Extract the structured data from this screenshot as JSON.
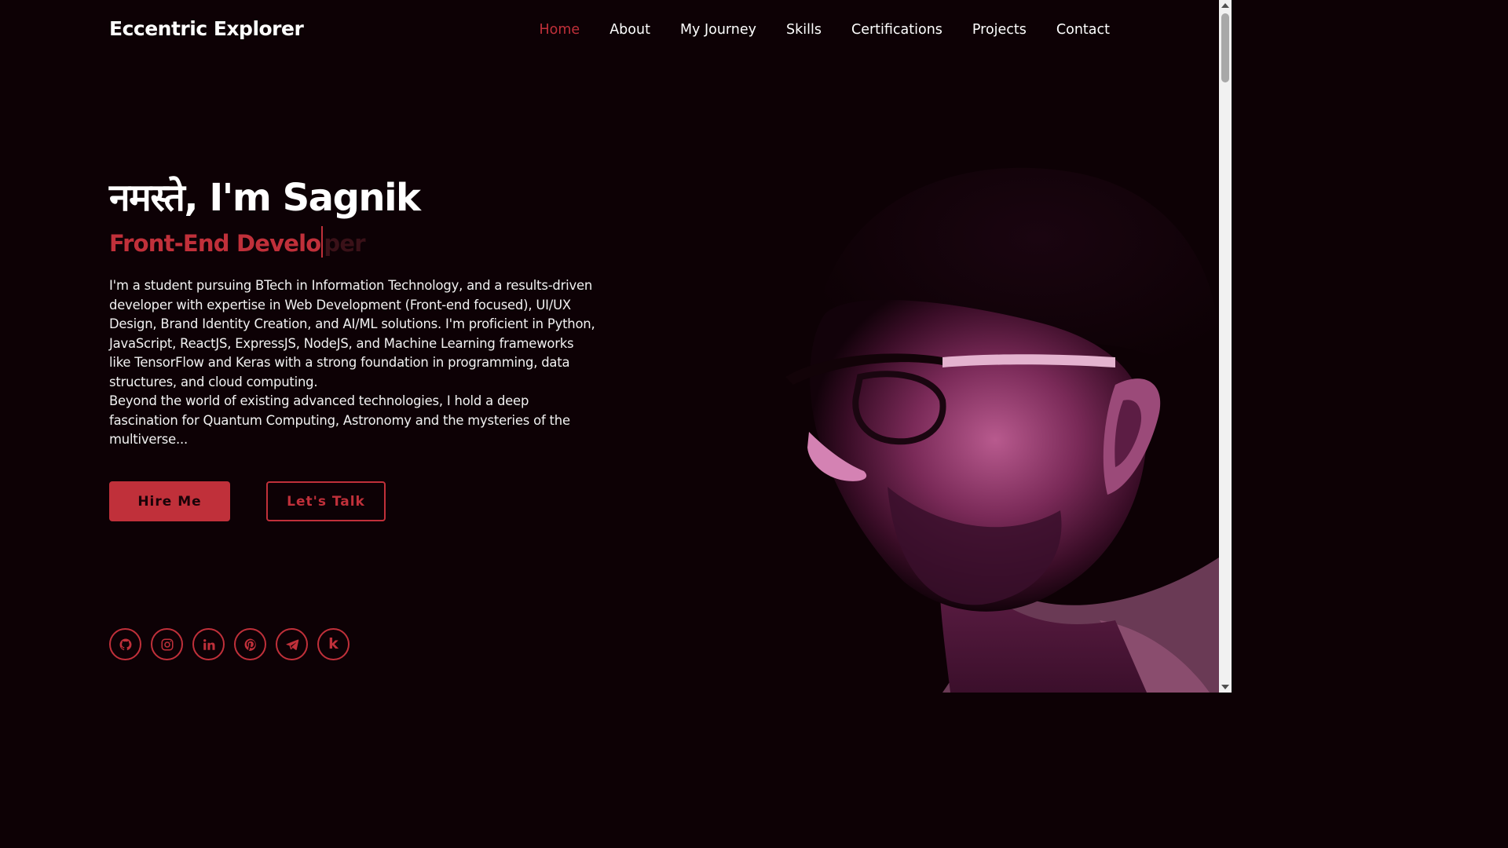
{
  "header": {
    "brand": "Eccentric Explorer",
    "nav": [
      {
        "label": "Home",
        "active": true
      },
      {
        "label": "About"
      },
      {
        "label": "My Journey"
      },
      {
        "label": "Skills"
      },
      {
        "label": "Certifications"
      },
      {
        "label": "Projects"
      },
      {
        "label": "Contact"
      }
    ]
  },
  "hero": {
    "greeting": "नमस्ते, I'm Sagnik",
    "role_typed": "Front-End Develo",
    "role_remaining": "per",
    "bio_paragraphs": [
      "I'm a student pursuing BTech in Information Technology, and a results-driven developer with expertise in Web Development (Front-end focused), UI/UX Design, Brand Identity Creation, and AI/ML solutions. I'm proficient in Python, JavaScript, ReactJS, ExpressJS, NodeJS, and Machine Learning frameworks like TensorFlow and Keras with a strong foundation in programming, data structures, and cloud computing.",
      "Beyond the world of existing advanced technologies, I hold a deep fascination for Quantum Computing, Astronomy and the mysteries of the multiverse..."
    ],
    "buttons": {
      "hire": "Hire Me",
      "talk": "Let's Talk"
    }
  },
  "socials": [
    {
      "icon": "github-icon"
    },
    {
      "icon": "instagram-icon"
    },
    {
      "icon": "linkedin-icon"
    },
    {
      "icon": "pinterest-icon"
    },
    {
      "icon": "telegram-icon"
    },
    {
      "icon": "kaggle-icon",
      "glyph": "k"
    }
  ],
  "colors": {
    "background": "#0d0105",
    "accent": "#c0303a",
    "text": "#ffffff"
  }
}
